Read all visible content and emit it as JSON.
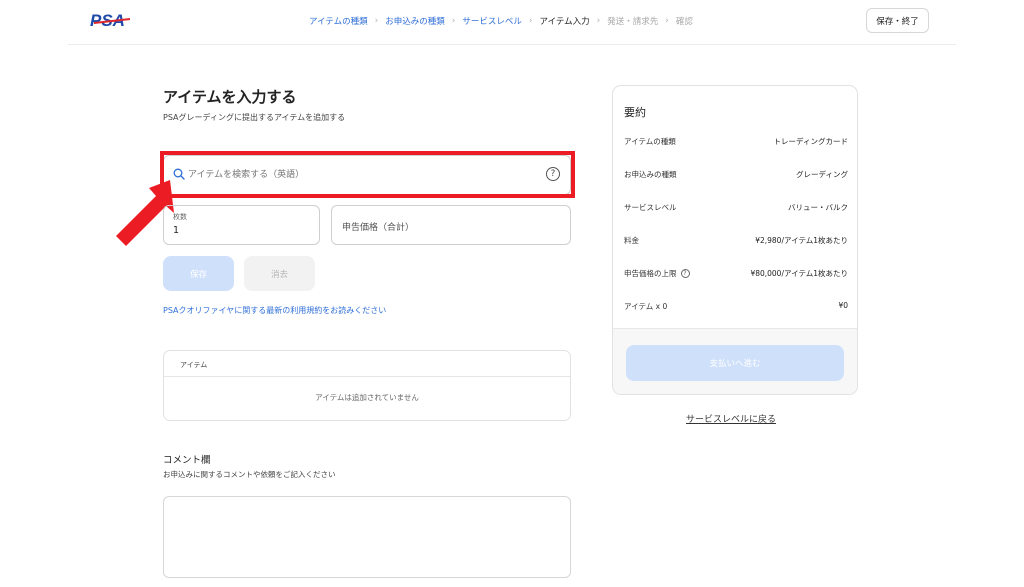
{
  "header": {
    "logo_text": "PSA",
    "breadcrumb": [
      {
        "label": "アイテムの種類",
        "state": "done"
      },
      {
        "label": "お申込みの種類",
        "state": "done"
      },
      {
        "label": "サービスレベル",
        "state": "done"
      },
      {
        "label": "アイテム入力",
        "state": "current"
      },
      {
        "label": "発送・請求先",
        "state": "pending"
      },
      {
        "label": "確認",
        "state": "pending"
      }
    ],
    "breadcrumb_separator": "›",
    "save_exit_label": "保存・終了"
  },
  "main": {
    "title": "アイテムを入力する",
    "subtitle": "PSAグレーディングに提出するアイテムを追加する",
    "search": {
      "placeholder": "アイテムを検索する（英語）",
      "icon": "search-icon",
      "help_icon_glyph": "?"
    },
    "quantity": {
      "label": "枚数",
      "value": "1"
    },
    "declared_value": {
      "placeholder": "申告価格（合計）"
    },
    "save_label": "保存",
    "clear_label": "消去",
    "terms_link": "PSAクオリファイヤに関する最新の利用規約をお読みください",
    "items_table": {
      "header": "アイテム",
      "empty_text": "アイテムは追加されていません"
    },
    "comment": {
      "title": "コメント欄",
      "subtitle": "お申込みに関するコメントや依頼をご記入ください"
    }
  },
  "summary": {
    "title": "要約",
    "rows": [
      {
        "label": "アイテムの種類",
        "value": "トレーディングカード"
      },
      {
        "label": "お申込みの種類",
        "value": "グレーディング"
      },
      {
        "label": "サービスレベル",
        "value": "バリュー・バルク"
      },
      {
        "label": "料金",
        "value": "¥2,980/アイテム1枚あたり"
      },
      {
        "label": "申告価格の上限",
        "value": "¥80,000/アイテム1枚あたり"
      },
      {
        "label": "アイテム x 0",
        "value": "¥0"
      }
    ],
    "pay_label": "支払いへ進む"
  },
  "back_link": "サービスレベルに戻る",
  "colors": {
    "link_blue": "#2f6fd8",
    "button_disabled_blue": "#cfe0fb",
    "highlight_red": "#ec1c24",
    "logo_blue": "#1f4aa8",
    "logo_red": "#e0242b"
  }
}
